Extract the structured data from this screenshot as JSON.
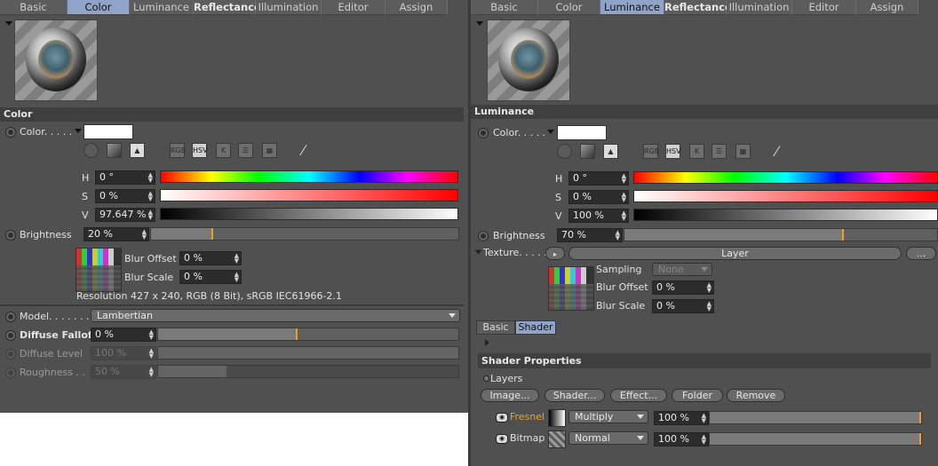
{
  "left": {
    "tabs": [
      "Basic",
      "Color",
      "Luminance",
      "Reflectance",
      "Illumination",
      "Editor",
      "Assign"
    ],
    "active_tab": "Color",
    "section_title": "Color",
    "color_label": "Color. . . . .",
    "mode_buttons": [
      "RGB",
      "HSV",
      "K"
    ],
    "h_label": "H",
    "h_value": "0 °",
    "s_label": "S",
    "s_value": "0 %",
    "v_label": "V",
    "v_value": "97.647 %",
    "brightness_label": "Brightness",
    "brightness_value": "20 %",
    "brightness_pct": 0.2,
    "blur_offset_label": "Blur Offset",
    "blur_offset_value": "0 %",
    "blur_scale_label": "Blur Scale",
    "blur_scale_value": "0 %",
    "resolution_text": "Resolution 427 x 240, RGB (8 Bit), sRGB IEC61966-2.1",
    "model_label": "Model. . . . . . .",
    "model_value": "Lambertian",
    "diffuse_falloff_label": "Diffuse Falloff",
    "diffuse_falloff_value": "0 %",
    "diffuse_level_label": "Diffuse Level",
    "diffuse_level_value": "100 %",
    "roughness_label": "Roughness . .",
    "roughness_value": "50 %"
  },
  "right": {
    "tabs": [
      "Basic",
      "Color",
      "Luminance",
      "Reflectance",
      "Illumination",
      "Editor",
      "Assign"
    ],
    "active_tab": "Luminance",
    "section_title": "Luminance",
    "color_label": "Color. . . . .",
    "mode_buttons": [
      "RGB",
      "HSV",
      "K"
    ],
    "h_label": "H",
    "h_value": "0 °",
    "s_label": "S",
    "s_value": "0 %",
    "v_label": "V",
    "v_value": "100 %",
    "brightness_label": "Brightness",
    "brightness_value": "70 %",
    "brightness_pct": 0.7,
    "texture_label": "Texture. . . . .",
    "texture_button": "Layer",
    "more_button": "...",
    "sampling_label": "Sampling",
    "sampling_value": "None",
    "blur_offset_label": "Blur Offset",
    "blur_offset_value": "0 %",
    "blur_scale_label": "Blur Scale",
    "blur_scale_value": "0 %",
    "subtabs": [
      "Basic",
      "Shader"
    ],
    "shader_properties_title": "Shader Properties",
    "layers_label": "Layers",
    "layer_buttons": [
      "Image...",
      "Shader...",
      "Effect...",
      "Folder",
      "Remove"
    ],
    "layer_rows": [
      {
        "name": "Fresnel",
        "blend": "Multiply",
        "value": "100 %",
        "pct": 1.0
      },
      {
        "name": "Bitmap",
        "blend": "Normal",
        "value": "100 %",
        "pct": 1.0
      }
    ]
  },
  "colors": {
    "accent": "#f0a020",
    "active_tab": "#8fa4c8",
    "fresnel_text": "#f0a020"
  }
}
